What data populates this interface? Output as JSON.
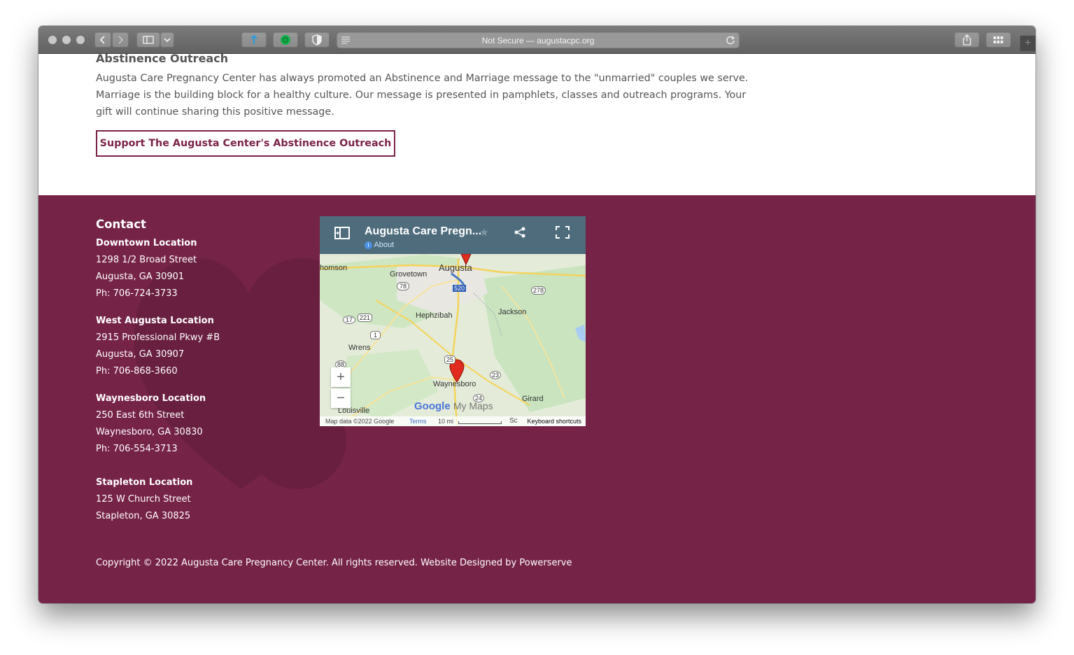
{
  "browser": {
    "address_text": "Not Secure — augustacpc.org",
    "new_tab_symbol": "+"
  },
  "content": {
    "section_title": "Abstinence Outreach",
    "paragraph": "Augusta Care Pregnancy Center has always promoted an Abstinence and Marriage message to the \"unmarried\" couples we serve. Marriage is the building block for a healthy culture. Our message is presented in pamphlets, classes and outreach programs. Your gift will continue sharing this positive message.",
    "cta_label": "Support The Augusta Center's Abstinence Outreach"
  },
  "footer": {
    "contact_title": "Contact",
    "locations": [
      {
        "name": "Downtown Location",
        "street": "1298 1/2 Broad Street",
        "city": "Augusta, GA 30901",
        "phone": "Ph: 706-724-3733"
      },
      {
        "name": "West Augusta Location",
        "street": "2915 Professional Pkwy #B",
        "city": "Augusta, GA 30907",
        "phone": "Ph: 706-868-3660"
      },
      {
        "name": "Waynesboro Location",
        "street": "250 East 6th Street",
        "city": "Waynesboro, GA 30830",
        "phone": "Ph: 706-554-3713"
      },
      {
        "name": "Stapleton Location",
        "street": "125 W Church Street",
        "city": "Stapleton, GA 30825"
      }
    ],
    "copyright": "Copyright © 2022 Augusta Care Pregnancy Center. All rights reserved. Website Designed by Powerserve"
  },
  "map": {
    "title": "Augusta Care Pregn...",
    "about_label": "About",
    "places": {
      "homson": "homson",
      "grovetown": "Grovetown",
      "augusta": "Augusta",
      "jackson": "Jackson",
      "hephzibah": "Hephzibah",
      "wrens": "Wrens",
      "waynesboro": "Waynesboro",
      "girard": "Girard",
      "louisville": "Louisville"
    },
    "routes": {
      "r78": "78",
      "r520": "520",
      "r278": "278",
      "r17": "17",
      "r221": "221",
      "r1": "1",
      "r88": "88",
      "r25": "25",
      "r23": "23",
      "r24": "24"
    },
    "brand": "Google",
    "brand_suffix": "My Maps",
    "zoom_in": "+",
    "zoom_out": "−",
    "attribution": "Map data ©2022 Google",
    "terms": "Terms",
    "scale": "10 mi",
    "partial_label": "Sc",
    "keyboard": "Keyboard shortcuts"
  },
  "colors": {
    "brand": "#762348",
    "map_header": "#4e6c7c"
  }
}
